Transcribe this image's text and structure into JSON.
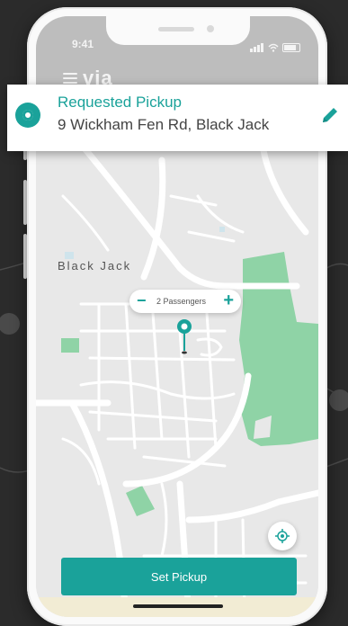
{
  "status_bar": {
    "time": "9:41"
  },
  "app": {
    "logo": "via"
  },
  "pickup_card": {
    "title": "Requested Pickup",
    "address": "9 Wickham Fen Rd, Black Jack"
  },
  "map": {
    "place_label": "Black Jack"
  },
  "passengers": {
    "minus": "−",
    "label": "2 Passengers",
    "plus": "+"
  },
  "actions": {
    "set_pickup": "Set Pickup"
  },
  "colors": {
    "accent": "#1aa29a",
    "park": "#8fd3a6",
    "road": "#ffffff",
    "background": "#2b2b2b"
  }
}
